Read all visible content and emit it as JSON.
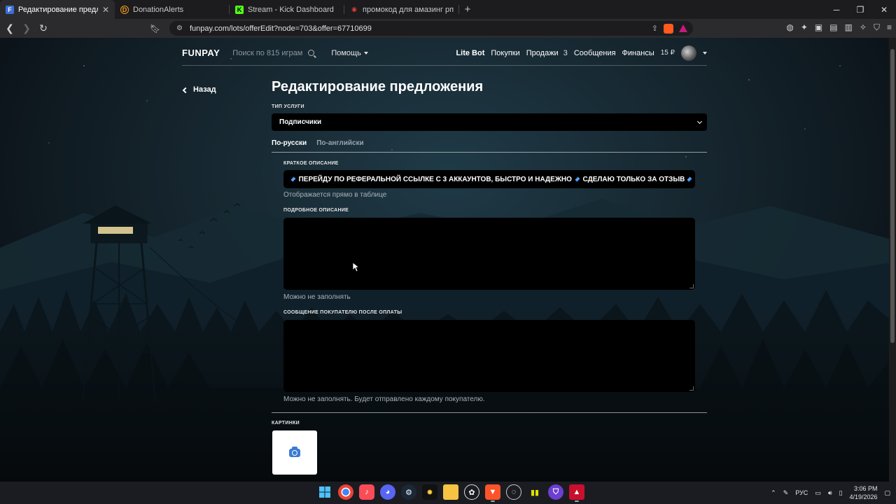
{
  "browser": {
    "tabs": [
      {
        "title": "Редактирование предложения",
        "fav": "F",
        "fav_color": "#3b6fd6",
        "active": true
      },
      {
        "title": "DonationAlerts",
        "fav": "D",
        "fav_color": "#f59c1a",
        "active": false
      },
      {
        "title": "Stream - Kick Dashboard",
        "fav": "K",
        "fav_color": "#53fc18",
        "active": false
      },
      {
        "title": "промокод для амазинг рп скай - Вс",
        "fav": "◉",
        "fav_color": "#e04040",
        "active": false
      }
    ],
    "url": "funpay.com/lots/offerEdit?node=703&offer=67710699"
  },
  "header": {
    "logo": "FUNPAY",
    "search_placeholder": "Поиск по 815 играм",
    "help": "Помощь",
    "nav": {
      "lite_bot": "Lite Bot",
      "purchases": "Покупки",
      "sales": "Продажи",
      "sales_count": "3",
      "messages": "Сообщения",
      "finances": "Финансы",
      "balance": "15 ₽"
    }
  },
  "form": {
    "back": "Назад",
    "title": "Редактирование предложения",
    "service_type_label": "Тип услуги",
    "service_type_value": "Подписчики",
    "tabs": [
      "По-русски",
      "По-английски"
    ],
    "short_desc_label": "Краткое описание",
    "short_desc_value_1": "ПЕРЕЙДУ ПО РЕФЕРАЛЬНОЙ ССЫЛКЕ С 3 АККАУНТОВ, БЫСТРО И НАДЕЖНО",
    "short_desc_value_2": "СДЕЛАЮ ТОЛЬКО ЗА ОТЗЫВ",
    "short_desc_hint": "Отображается прямо в таблице",
    "long_desc_label": "Подробное описание",
    "long_desc_hint": "Можно не заполнять",
    "buyer_msg_label": "Сообщение покупателю после оплаты",
    "buyer_msg_hint": "Можно не заполнять. Будет отправлено каждому покупателю.",
    "images_label": "Картинки"
  },
  "system": {
    "lang": "РУС",
    "time": "3:06 PM",
    "date": "4/19/2026"
  }
}
